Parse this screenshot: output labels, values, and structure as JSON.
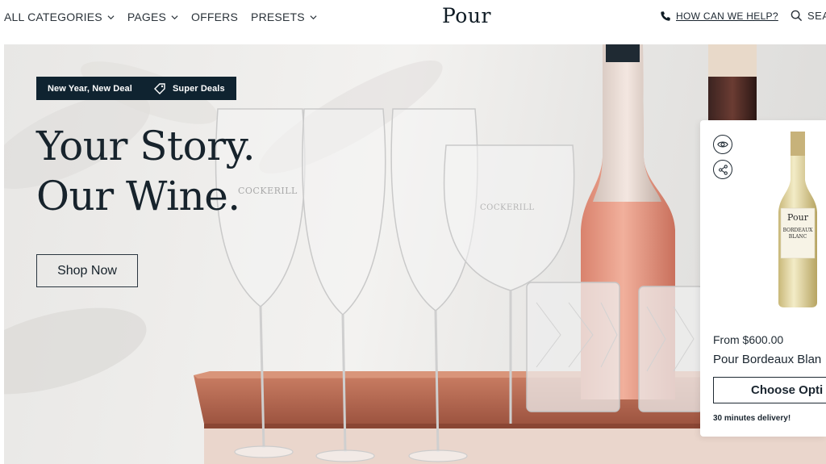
{
  "header": {
    "nav": [
      {
        "label": "ALL CATEGORIES",
        "has_dropdown": true
      },
      {
        "label": "PAGES",
        "has_dropdown": true
      },
      {
        "label": "OFFERS",
        "has_dropdown": false
      },
      {
        "label": "PRESETS",
        "has_dropdown": true
      }
    ],
    "logo": "Pour",
    "help_link": "HOW CAN WE HELP?",
    "help_icon": "phone-icon",
    "search_label": "SEA",
    "search_icon": "search-icon"
  },
  "hero": {
    "badges": [
      {
        "label": "New Year, New Deal"
      },
      {
        "label": "Super Deals",
        "icon": "tag-icon"
      }
    ],
    "headline_line1": "Your Story.",
    "headline_line2": "Our Wine.",
    "cta_label": "Shop Now",
    "glass_brand": "COCKERILL"
  },
  "product_card": {
    "quick_view_icon": "eye-icon",
    "share_icon": "share-icon",
    "bottle_label_brand": "Pour",
    "bottle_label_line1": "BORDEAUX",
    "bottle_label_line2": "BLANC",
    "price": "From $600.00",
    "name": "Pour Bordeaux Blan",
    "cta_label": "Choose Opti",
    "delivery_note": "30 minutes delivery!"
  },
  "colors": {
    "badge_bg": "#0f2330",
    "text_dark": "#17232c",
    "rose_wine": "#e79a84",
    "tray": "#b86a52"
  }
}
